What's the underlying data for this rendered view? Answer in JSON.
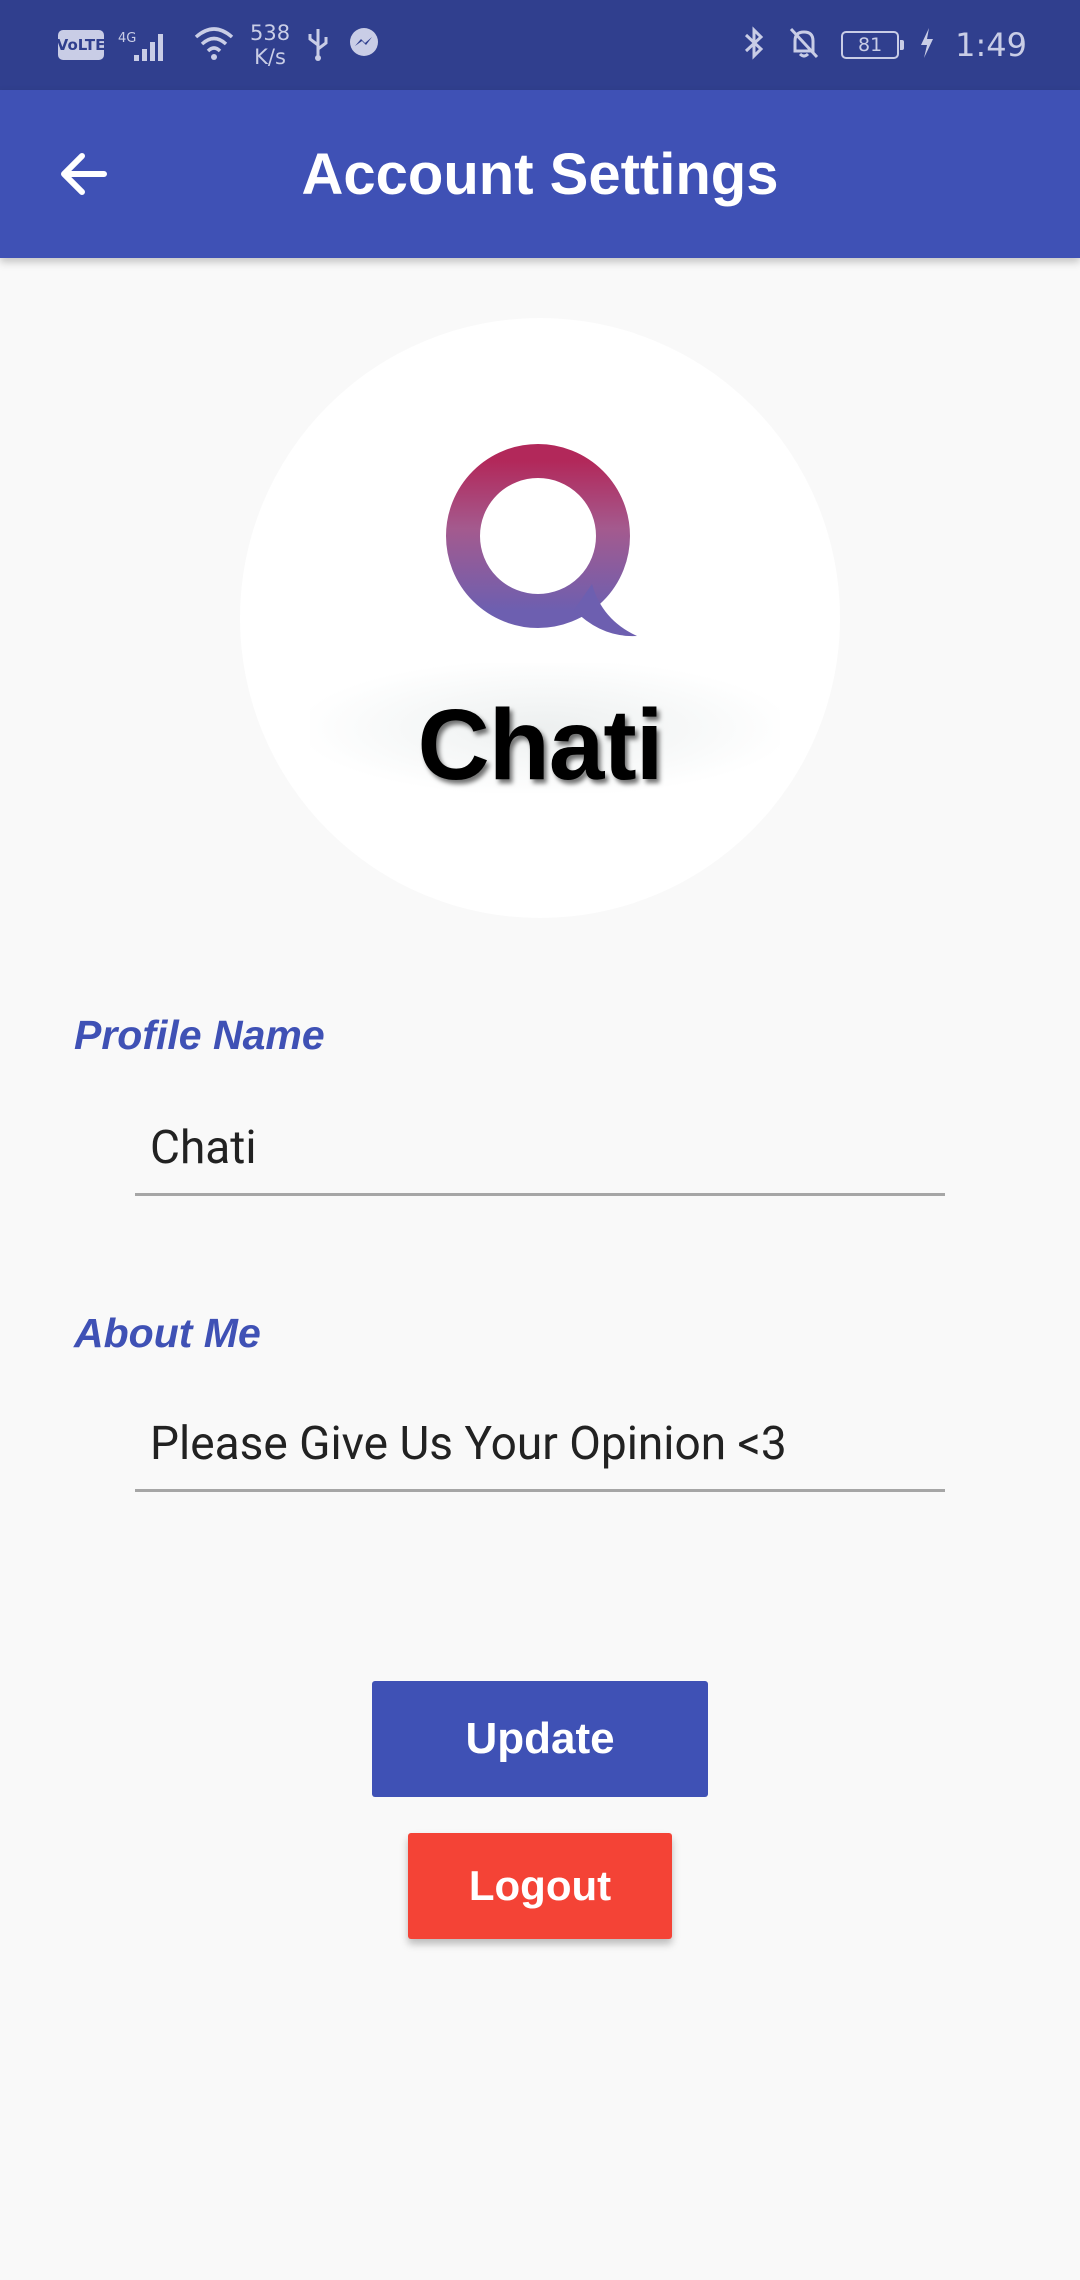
{
  "status_bar": {
    "volte": "VoLTE",
    "network": "4G",
    "speed_value": "538",
    "speed_unit": "K/s",
    "battery": "81",
    "time": "1:49"
  },
  "app_bar": {
    "title": "Account Settings"
  },
  "profile": {
    "logo_text": "Chati"
  },
  "form": {
    "profile_name_label": "Profile Name",
    "profile_name_value": "Chati",
    "about_label": "About Me",
    "about_value": "Please Give Us Your Opinion <3"
  },
  "actions": {
    "update_label": "Update",
    "logout_label": "Logout"
  },
  "colors": {
    "primary": "#3f51b5",
    "primary_dark": "#303f8e",
    "logout": "#f44336"
  }
}
